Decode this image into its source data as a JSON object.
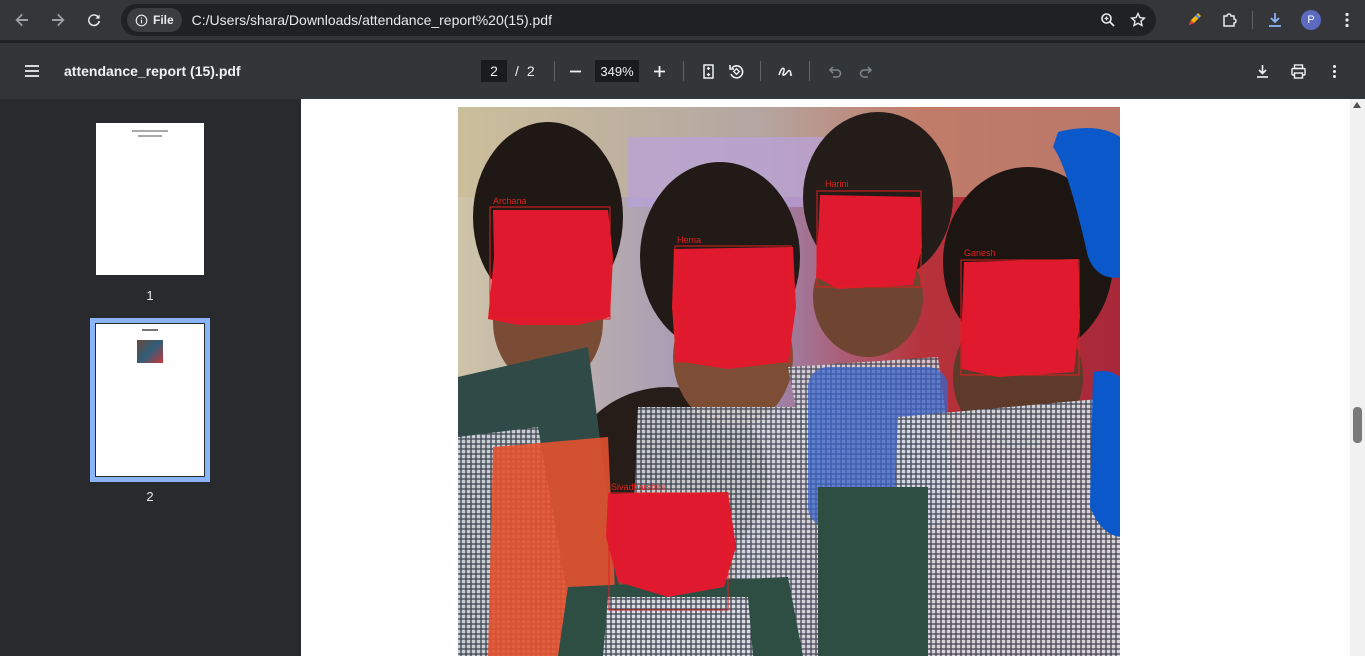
{
  "browser": {
    "site_chip_label": "File",
    "url": "C:/Users/shara/Downloads/attendance_report%20(15).pdf",
    "avatar_letter": "P"
  },
  "pdf": {
    "title": "attendance_report (15).pdf",
    "current_page": "2",
    "separator": "/",
    "total_pages": "2",
    "zoom": "349%"
  },
  "thumbnails": [
    {
      "label": "1"
    },
    {
      "label": "2"
    }
  ],
  "face_labels": [
    "Archana",
    "Hema",
    "Harini",
    "Ganesh",
    "Sivadharshini"
  ],
  "colors": {
    "chrome_bg": "#35363a",
    "toolbar_bg": "#323639",
    "sidebar_bg": "#282a2d",
    "selection": "#8ab4f8",
    "redaction": "#e0192f",
    "blue_mark": "#0a58c9"
  }
}
